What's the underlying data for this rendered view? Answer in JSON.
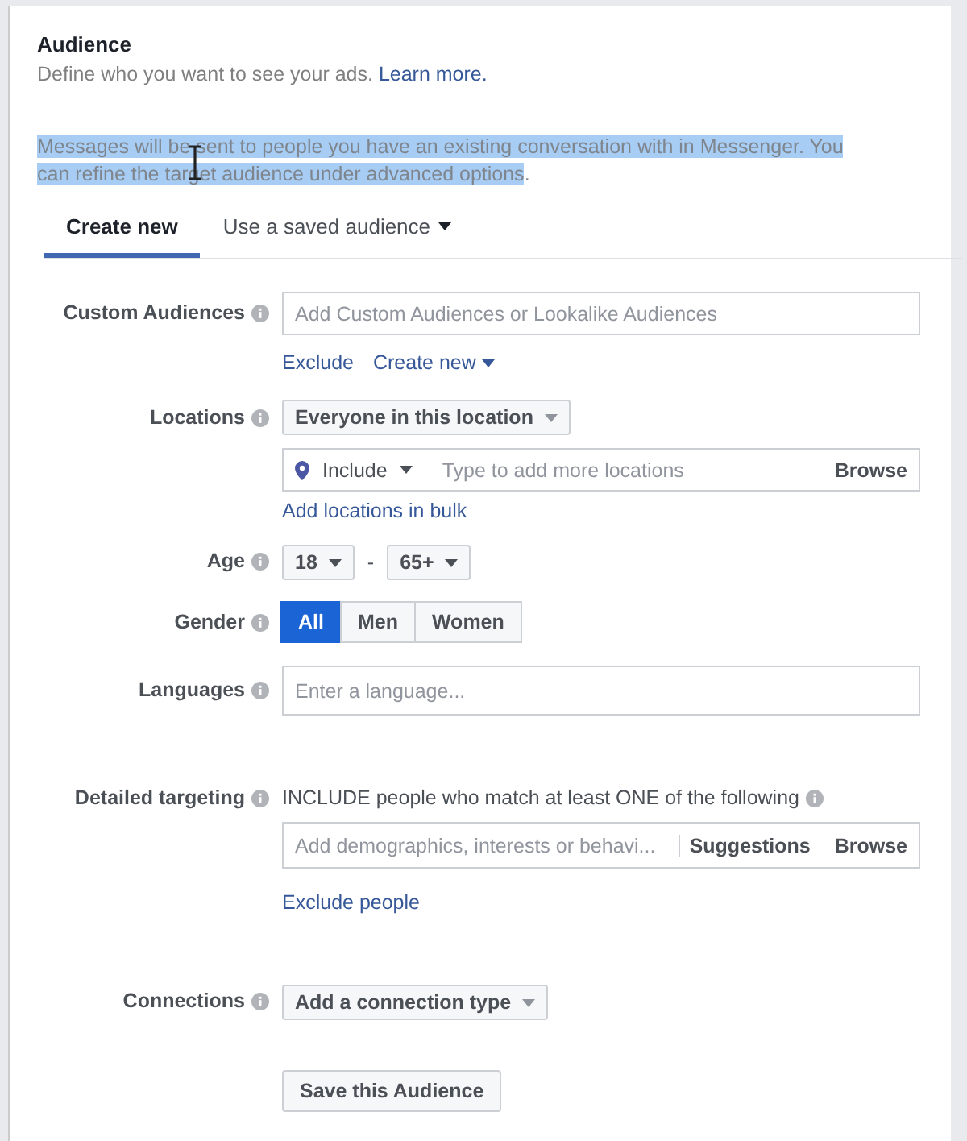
{
  "section": {
    "title": "Audience",
    "subtitle": "Define who you want to see your ads.",
    "learn_more": "Learn more."
  },
  "message": {
    "text": "Messages will be sent to people you have an existing conversation with in Messenger. You can refine the target audience under advanced options",
    "highlighted": true,
    "trailing": "."
  },
  "tabs": [
    {
      "label": "Create new",
      "selected": true,
      "dropdown": false
    },
    {
      "label": "Use a saved audience",
      "selected": false,
      "dropdown": true
    }
  ],
  "custom_audiences": {
    "label": "Custom Audiences",
    "placeholder": "Add Custom Audiences or Lookalike Audiences",
    "links": [
      {
        "label": "Exclude",
        "dropdown": false
      },
      {
        "label": "Create new",
        "dropdown": true
      }
    ]
  },
  "locations": {
    "label": "Locations",
    "audience_dropdown": "Everyone in this location",
    "include_dropdown": "Include",
    "placeholder": "Type to add more locations",
    "browse": "Browse",
    "bulk_link": "Add locations in bulk"
  },
  "age": {
    "label": "Age",
    "min": "18",
    "separator": "-",
    "max": "65+"
  },
  "gender": {
    "label": "Gender",
    "options": [
      {
        "label": "All",
        "selected": true
      },
      {
        "label": "Men",
        "selected": false
      },
      {
        "label": "Women",
        "selected": false
      }
    ]
  },
  "languages": {
    "label": "Languages",
    "placeholder": "Enter a language..."
  },
  "detailed_targeting": {
    "label": "Detailed targeting",
    "heading": "INCLUDE people who match at least ONE of the following",
    "placeholder": "Add demographics, interests or behavi...",
    "suggestions": "Suggestions",
    "browse": "Browse",
    "exclude_link": "Exclude people"
  },
  "connections": {
    "label": "Connections",
    "dropdown": "Add a connection type"
  },
  "save_button": "Save this Audience"
}
